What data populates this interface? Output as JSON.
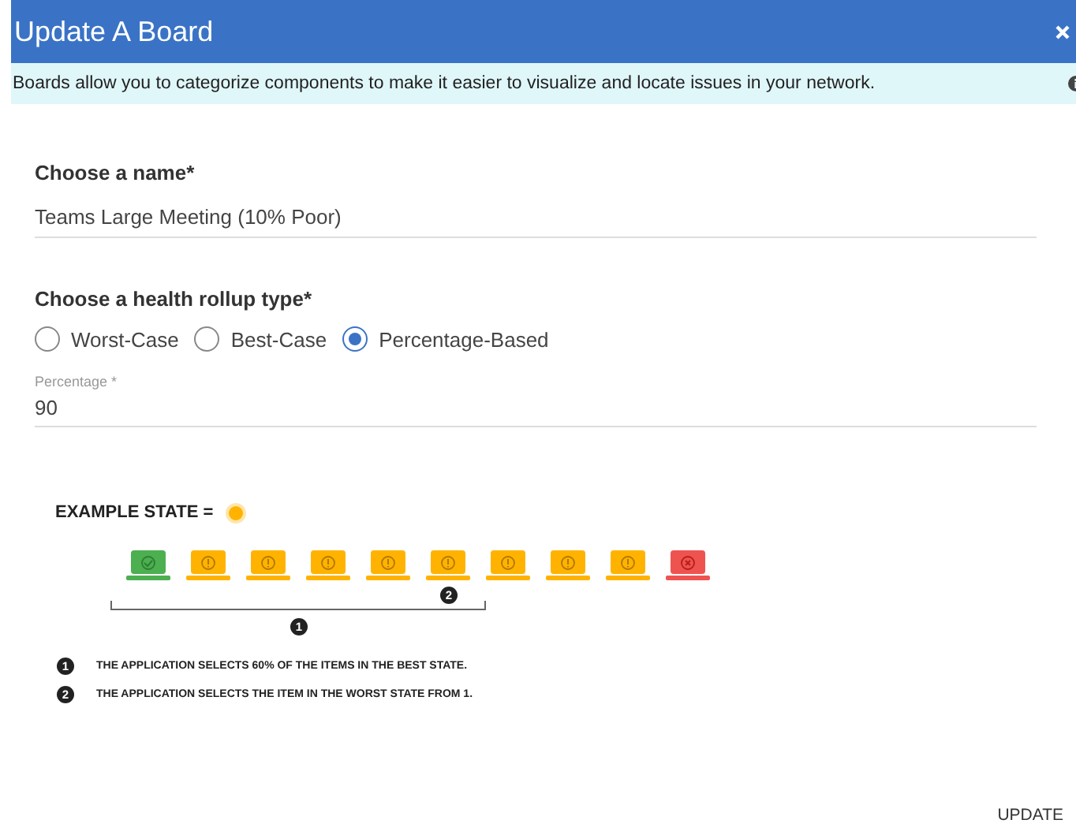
{
  "dialog": {
    "title": "Update A Board"
  },
  "info": {
    "text": "Boards allow you to categorize components to make it easier to visualize and locate issues in your network."
  },
  "name_field": {
    "label": "Choose a name*",
    "value": "Teams Large Meeting (10% Poor)"
  },
  "rollup": {
    "label": "Choose a health rollup type*",
    "options": [
      {
        "label": "Worst-Case",
        "selected": false
      },
      {
        "label": "Best-Case",
        "selected": false
      },
      {
        "label": "Percentage-Based",
        "selected": true
      }
    ]
  },
  "percentage_field": {
    "label": "Percentage *",
    "value": "90"
  },
  "example": {
    "label": "EXAMPLE STATE =",
    "state": {
      "kind": "warn"
    },
    "bracket_number": "1",
    "pick_number": "2",
    "items": [
      {
        "kind": "ok",
        "picked": false
      },
      {
        "kind": "warn",
        "picked": false
      },
      {
        "kind": "warn",
        "picked": false
      },
      {
        "kind": "warn",
        "picked": false
      },
      {
        "kind": "warn",
        "picked": false
      },
      {
        "kind": "warn",
        "picked": true
      },
      {
        "kind": "warn",
        "picked": false
      },
      {
        "kind": "warn",
        "picked": false
      },
      {
        "kind": "warn",
        "picked": false
      },
      {
        "kind": "error",
        "picked": false
      }
    ],
    "legend": [
      {
        "number": "1",
        "text": "THE APPLICATION SELECTS 60% OF THE ITEMS IN THE BEST STATE."
      },
      {
        "number": "2",
        "text": "THE APPLICATION SELECTS THE ITEM IN THE WORST STATE FROM 1."
      }
    ]
  },
  "buttons": [
    {
      "label": "UPDATE"
    }
  ]
}
